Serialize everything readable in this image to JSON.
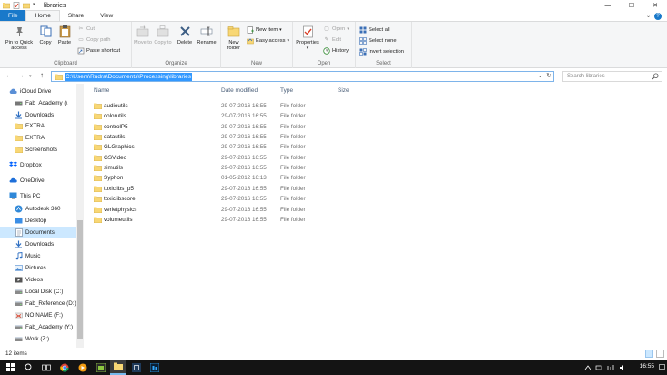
{
  "window": {
    "title": "libraries",
    "minimize": "—",
    "maximize": "☐",
    "close": "✕"
  },
  "tabs": {
    "file": "File",
    "home": "Home",
    "share": "Share",
    "view": "View"
  },
  "ribbon": {
    "clipboard": {
      "pin": "Pin to Quick access",
      "copy": "Copy",
      "paste": "Paste",
      "cut": "Cut",
      "copy_path": "Copy path",
      "paste_shortcut": "Paste shortcut",
      "label": "Clipboard"
    },
    "organize": {
      "move_to": "Move to",
      "copy_to": "Copy to",
      "delete": "Delete",
      "rename": "Rename",
      "label": "Organize"
    },
    "new": {
      "new_folder": "New folder",
      "new_item": "New item",
      "easy_access": "Easy access",
      "label": "New"
    },
    "open": {
      "properties": "Properties",
      "open": "Open",
      "edit": "Edit",
      "history": "History",
      "label": "Open"
    },
    "select": {
      "select_all": "Select all",
      "select_none": "Select none",
      "invert": "Invert selection",
      "label": "Select"
    }
  },
  "address": {
    "path": "C:\\Users\\Rudra\\Documents\\Processing\\libraries",
    "search_placeholder": "Search libraries"
  },
  "nav": [
    {
      "label": "iCloud Drive",
      "icon": "cloud-icon"
    },
    {
      "label": "Fab_Academy (\\",
      "icon": "drive-icon"
    },
    {
      "label": "Downloads",
      "icon": "download-icon"
    },
    {
      "label": "EXTRA",
      "icon": "folder-icon"
    },
    {
      "label": "EXTRA",
      "icon": "folder-icon"
    },
    {
      "label": "Screenshots",
      "icon": "folder-icon"
    },
    {
      "label": "Dropbox",
      "icon": "dropbox-icon"
    },
    {
      "label": "OneDrive",
      "icon": "onedrive-icon"
    },
    {
      "label": "This PC",
      "icon": "pc-icon"
    },
    {
      "label": "Autodesk 360",
      "icon": "autodesk-icon"
    },
    {
      "label": "Desktop",
      "icon": "desktop-icon"
    },
    {
      "label": "Documents",
      "icon": "documents-icon"
    },
    {
      "label": "Downloads",
      "icon": "download-icon"
    },
    {
      "label": "Music",
      "icon": "music-icon"
    },
    {
      "label": "Pictures",
      "icon": "pictures-icon"
    },
    {
      "label": "Videos",
      "icon": "videos-icon"
    },
    {
      "label": "Local Disk (C:)",
      "icon": "disk-icon"
    },
    {
      "label": "Fab_Reference (D:)",
      "icon": "disk-icon"
    },
    {
      "label": "NO NAME (F:)",
      "icon": "usb-icon"
    },
    {
      "label": "Fab_Academy (Y:)",
      "icon": "disk-icon"
    },
    {
      "label": "Work (Z:)",
      "icon": "disk-icon"
    }
  ],
  "columns": {
    "name": "Name",
    "date": "Date modified",
    "type": "Type",
    "size": "Size"
  },
  "files": [
    {
      "name": "audioutils",
      "date": "29-07-2016 16:55",
      "type": "File folder"
    },
    {
      "name": "colorutils",
      "date": "29-07-2016 16:55",
      "type": "File folder"
    },
    {
      "name": "controlP5",
      "date": "29-07-2016 16:55",
      "type": "File folder"
    },
    {
      "name": "datautils",
      "date": "29-07-2016 16:55",
      "type": "File folder"
    },
    {
      "name": "GLGraphics",
      "date": "29-07-2016 16:55",
      "type": "File folder"
    },
    {
      "name": "GSVideo",
      "date": "29-07-2016 16:55",
      "type": "File folder"
    },
    {
      "name": "simutils",
      "date": "29-07-2016 16:55",
      "type": "File folder"
    },
    {
      "name": "Syphon",
      "date": "01-05-2012 16:13",
      "type": "File folder"
    },
    {
      "name": "toxiclibs_p5",
      "date": "29-07-2016 16:55",
      "type": "File folder"
    },
    {
      "name": "toxiclibscore",
      "date": "29-07-2016 16:55",
      "type": "File folder"
    },
    {
      "name": "verletphysics",
      "date": "29-07-2016 16:55",
      "type": "File folder"
    },
    {
      "name": "volumeutils",
      "date": "29-07-2016 16:55",
      "type": "File folder"
    }
  ],
  "status": {
    "count": "12 items"
  },
  "taskbar": {
    "clock": "16:55"
  },
  "colors": {
    "accent": "#1979ca",
    "folder": "#f8d775",
    "selection": "#cce8ff"
  }
}
